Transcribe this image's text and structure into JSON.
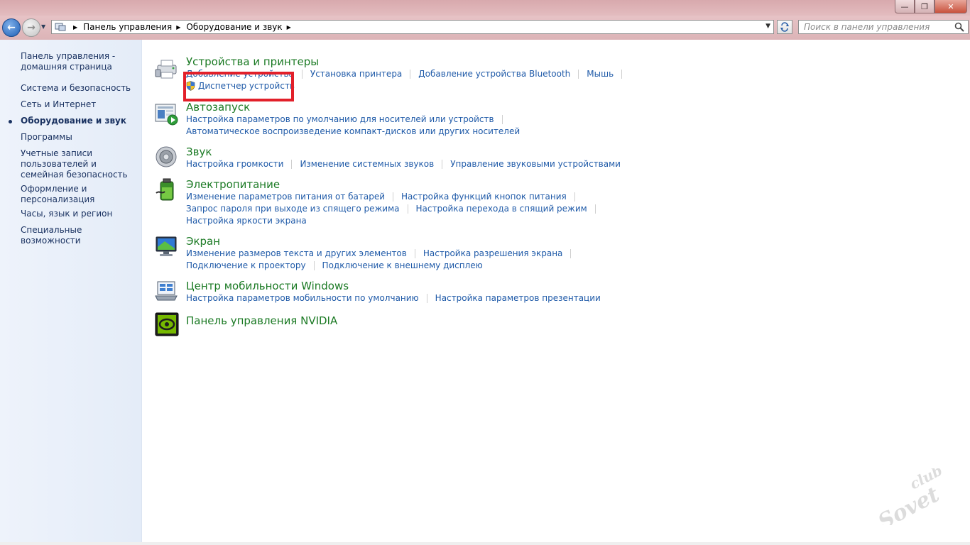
{
  "window": {
    "minimize_label": "—",
    "maximize_label": "❐",
    "close_label": "✕"
  },
  "nav": {
    "back_label": "←",
    "forward_label": "→",
    "breadcrumbs": [
      "Панель управления",
      "Оборудование и звук"
    ],
    "search_placeholder": "Поиск в панели управления"
  },
  "sidebar": {
    "items": [
      {
        "label": "Панель управления - домашняя страница"
      },
      {
        "label": "Система и безопасность"
      },
      {
        "label": "Сеть и Интернет"
      },
      {
        "label": "Оборудование и звук",
        "current": true
      },
      {
        "label": "Программы"
      },
      {
        "label": "Учетные записи пользователей и семейная безопасность"
      },
      {
        "label": "Оформление и персонализация"
      },
      {
        "label": "Часы, язык и регион"
      },
      {
        "label": "Специальные возможности"
      }
    ]
  },
  "categories": [
    {
      "title": "Устройства и принтеры",
      "icon": "printer-icon",
      "rows": [
        [
          "Добавление устройства",
          "Установка принтера",
          "Добавление устройства Bluetooth",
          "Мышь"
        ],
        [
          "Диспетчер устройств"
        ]
      ]
    },
    {
      "title": "Автозапуск",
      "icon": "autoplay-icon",
      "rows": [
        [
          "Настройка параметров по умолчанию для носителей или устройств"
        ],
        [
          "Автоматическое воспроизведение компакт-дисков или других носителей"
        ]
      ]
    },
    {
      "title": "Звук",
      "icon": "speaker-icon",
      "rows": [
        [
          "Настройка громкости",
          "Изменение системных звуков",
          "Управление звуковыми устройствами"
        ]
      ]
    },
    {
      "title": "Электропитание",
      "icon": "battery-icon",
      "rows": [
        [
          "Изменение параметров питания от батарей",
          "Настройка функций кнопок питания"
        ],
        [
          "Запрос пароля при выходе из спящего режима",
          "Настройка перехода в спящий режим"
        ],
        [
          "Настройка яркости экрана"
        ]
      ]
    },
    {
      "title": "Экран",
      "icon": "monitor-icon",
      "rows": [
        [
          "Изменение размеров текста и других элементов",
          "Настройка разрешения экрана"
        ],
        [
          "Подключение к проектору",
          "Подключение к внешнему дисплею"
        ]
      ]
    },
    {
      "title": "Центр мобильности Windows",
      "icon": "mobility-center-icon",
      "rows": [
        [
          "Настройка параметров мобильности по умолчанию",
          "Настройка параметров презентации"
        ]
      ]
    },
    {
      "title": "Панель управления NVIDIA",
      "icon": "nvidia-icon",
      "rows": []
    }
  ],
  "watermark": {
    "text_top": "club",
    "text_bottom": "Sovet"
  },
  "colors": {
    "category_title": "#1b7a24",
    "link": "#1f5aa8",
    "sidebar_text": "#1a3261",
    "highlight": "#e2202a"
  }
}
